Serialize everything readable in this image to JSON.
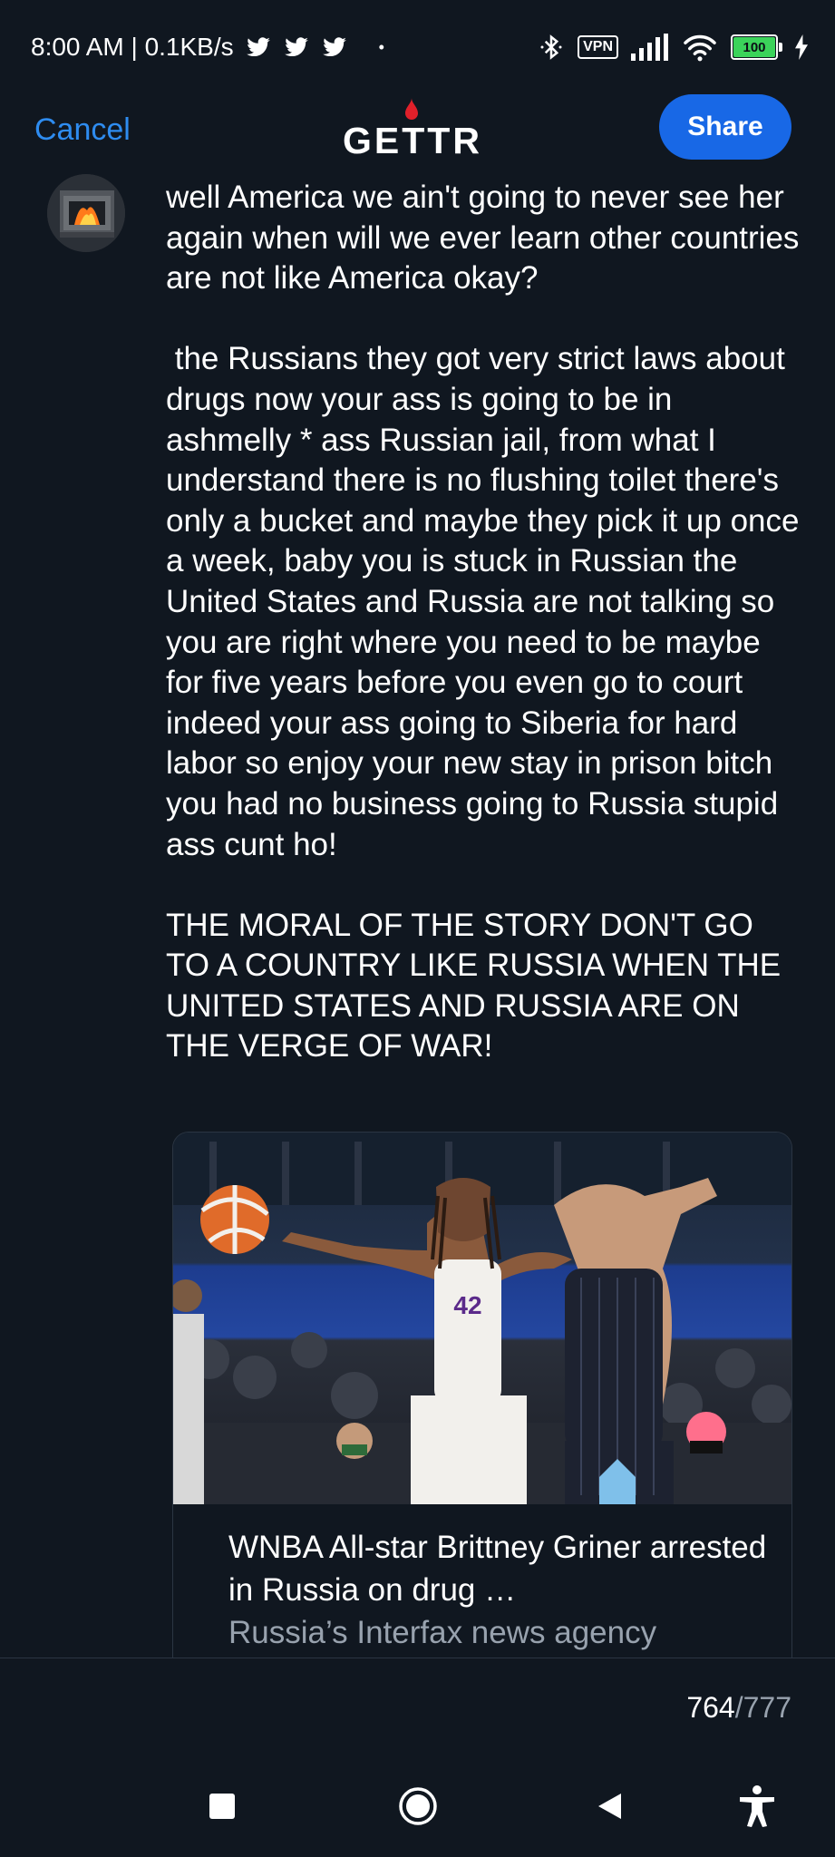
{
  "status_bar": {
    "time_and_speed": "8:00 AM | 0.1KB/s",
    "dot": "•",
    "vpn_label": "VPN",
    "battery_level": "100",
    "icons": [
      "twitter-icon",
      "twitter-icon",
      "twitter-icon",
      "bluetooth-icon",
      "signal-icon",
      "wifi-icon",
      "battery-icon",
      "charging-icon"
    ]
  },
  "nav": {
    "cancel_label": "Cancel",
    "logo_text": "GETTR",
    "share_label": "Share"
  },
  "post": {
    "text": "well America we ain't going to never see her again when will we ever learn other countries are not like America okay?\n\n the Russians they got very strict laws about drugs now your ass is going to be in ashmelly * ass Russian jail, from what I understand there is no flushing toilet there's only a bucket and maybe they pick it up once a week, baby you is stuck in Russian the United States and Russia are not talking so you are right where you need to be maybe for five years before you even go to court indeed your ass going to Siberia for hard labor so enjoy your new stay in prison bitch you had no business going to Russia stupid ass cunt ho!\n\nTHE MORAL OF THE STORY DON'T GO TO A COUNTRY LIKE RUSSIA WHEN THE UNITED STATES AND RUSSIA ARE ON THE VERGE OF WAR!"
  },
  "link_card": {
    "title": "WNBA All-star Brittney Griner arrested in Russia on drug …",
    "source": "Russia’s Interfax news agency",
    "jersey_number": "42"
  },
  "compose": {
    "char_used": "764",
    "separator": "/",
    "char_max": "777"
  },
  "colors": {
    "background": "#101720",
    "accent_blue": "#1868e6",
    "link_blue": "#2e8cf0",
    "muted_text": "#98a2ae",
    "logo_red": "#e0202a"
  }
}
